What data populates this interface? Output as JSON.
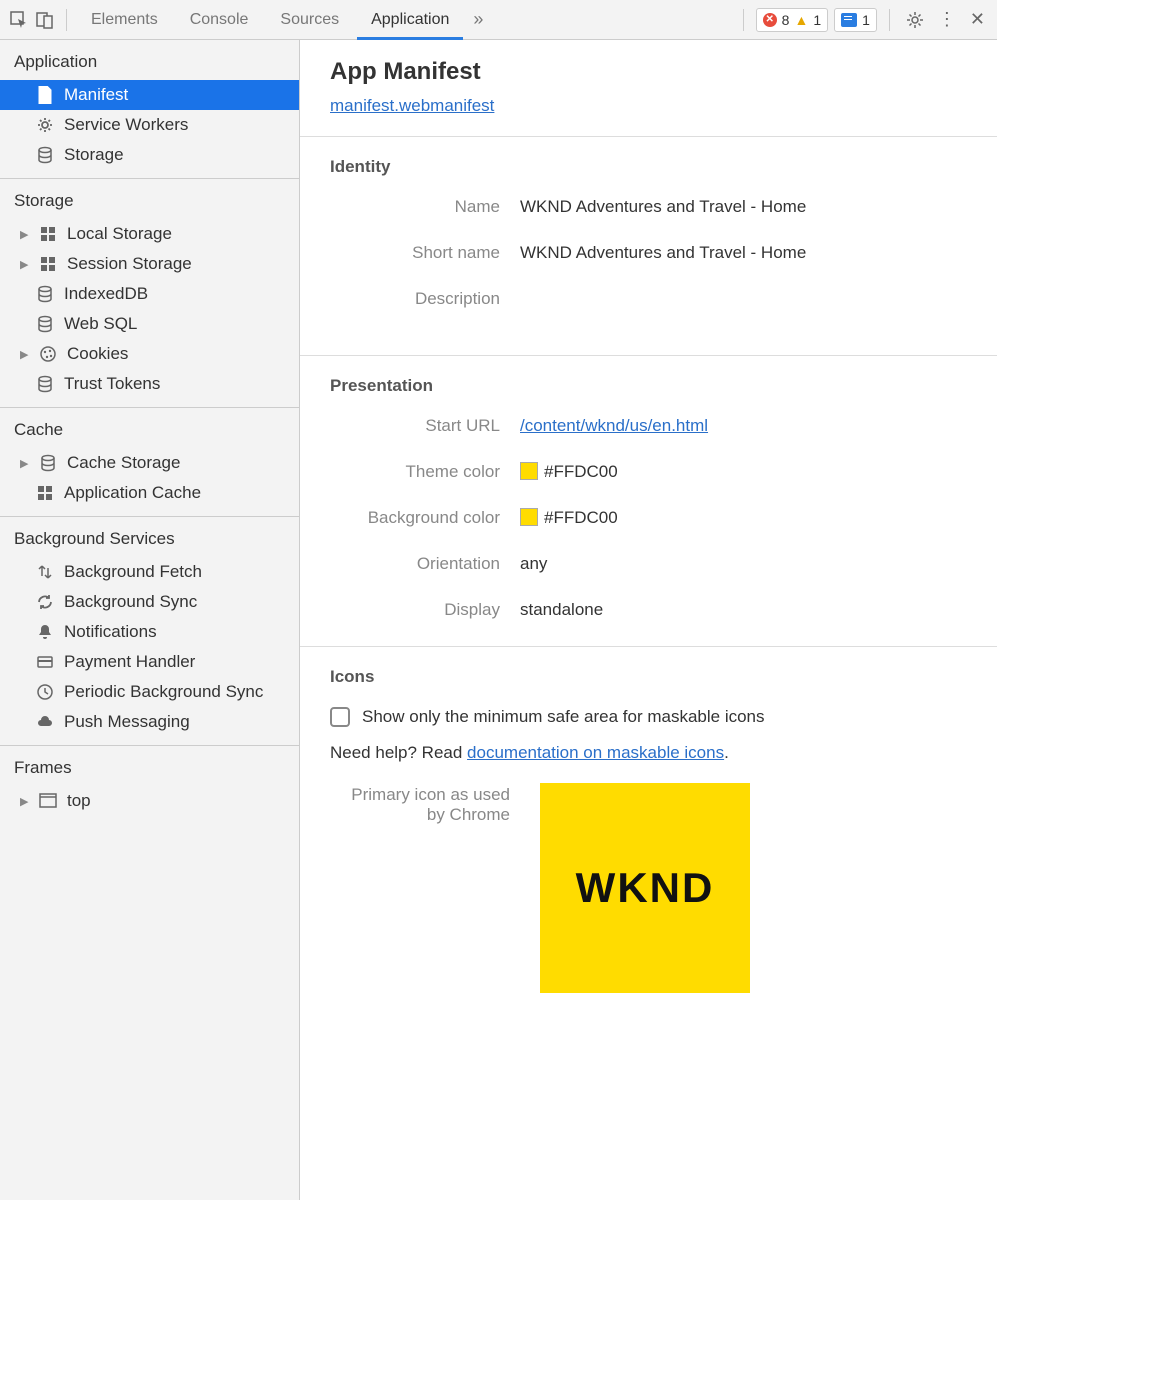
{
  "toolbar": {
    "tabs": [
      "Elements",
      "Console",
      "Sources",
      "Application"
    ],
    "active_tab": "Application",
    "errors": "8",
    "warnings": "1",
    "messages": "1"
  },
  "sidebar": {
    "groups": [
      {
        "title": "Application",
        "items": [
          {
            "icon": "file",
            "label": "Manifest",
            "selected": true,
            "expandable": false
          },
          {
            "icon": "gear",
            "label": "Service Workers",
            "expandable": false
          },
          {
            "icon": "db",
            "label": "Storage",
            "expandable": false
          }
        ]
      },
      {
        "title": "Storage",
        "items": [
          {
            "icon": "grid",
            "label": "Local Storage",
            "expandable": true
          },
          {
            "icon": "grid",
            "label": "Session Storage",
            "expandable": true
          },
          {
            "icon": "db",
            "label": "IndexedDB",
            "expandable": false
          },
          {
            "icon": "db",
            "label": "Web SQL",
            "expandable": false
          },
          {
            "icon": "cookie",
            "label": "Cookies",
            "expandable": true
          },
          {
            "icon": "db",
            "label": "Trust Tokens",
            "expandable": false
          }
        ]
      },
      {
        "title": "Cache",
        "items": [
          {
            "icon": "db",
            "label": "Cache Storage",
            "expandable": true
          },
          {
            "icon": "grid",
            "label": "Application Cache",
            "expandable": false
          }
        ]
      },
      {
        "title": "Background Services",
        "items": [
          {
            "icon": "updown",
            "label": "Background Fetch",
            "expandable": false
          },
          {
            "icon": "sync",
            "label": "Background Sync",
            "expandable": false
          },
          {
            "icon": "bell",
            "label": "Notifications",
            "expandable": false
          },
          {
            "icon": "card",
            "label": "Payment Handler",
            "expandable": false
          },
          {
            "icon": "clock",
            "label": "Periodic Background Sync",
            "expandable": false
          },
          {
            "icon": "cloud",
            "label": "Push Messaging",
            "expandable": false
          }
        ]
      },
      {
        "title": "Frames",
        "items": [
          {
            "icon": "frame",
            "label": "top",
            "expandable": true
          }
        ]
      }
    ]
  },
  "main": {
    "title": "App Manifest",
    "manifest_link": "manifest.webmanifest",
    "identity": {
      "title": "Identity",
      "name_label": "Name",
      "name_value": "WKND Adventures and Travel - Home",
      "shortname_label": "Short name",
      "shortname_value": "WKND Adventures and Travel - Home",
      "description_label": "Description",
      "description_value": ""
    },
    "presentation": {
      "title": "Presentation",
      "starturl_label": "Start URL",
      "starturl_value": "/content/wknd/us/en.html",
      "theme_label": "Theme color",
      "theme_value": "#FFDC00",
      "bg_label": "Background color",
      "bg_value": "#FFDC00",
      "orientation_label": "Orientation",
      "orientation_value": "any",
      "display_label": "Display",
      "display_value": "standalone"
    },
    "icons": {
      "title": "Icons",
      "checkbox_label": "Show only the minimum safe area for maskable icons",
      "help_prefix": "Need help? Read ",
      "help_link": "documentation on maskable icons",
      "help_suffix": ".",
      "primary_label": "Primary icon as used by Chrome",
      "icon_text": "WKND",
      "icon_bg": "#FFDC00"
    }
  }
}
